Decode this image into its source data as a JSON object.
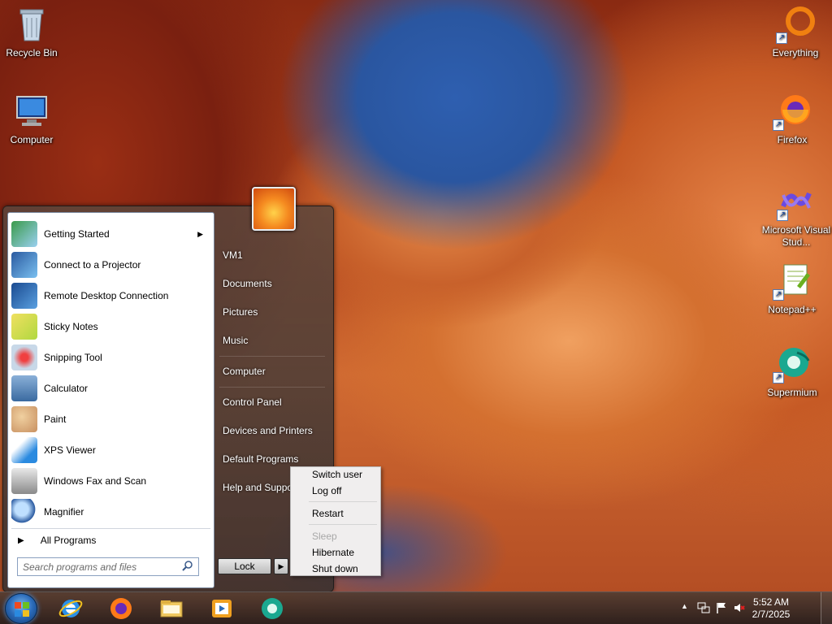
{
  "desktop": {
    "icons": [
      {
        "label": "Recycle Bin",
        "icon": "recycle-bin-icon"
      },
      {
        "label": "Computer",
        "icon": "computer-icon"
      },
      {
        "label": "Everything",
        "icon": "everything-icon"
      },
      {
        "label": "Firefox",
        "icon": "firefox-icon"
      },
      {
        "label": "Microsoft Visual Stud...",
        "icon": "visual-studio-icon"
      },
      {
        "label": "Notepad++",
        "icon": "notepad-plus-plus-icon"
      },
      {
        "label": "Supermium",
        "icon": "supermium-icon"
      }
    ]
  },
  "start_menu": {
    "programs": [
      {
        "label": "Getting Started",
        "icon": "getting-started-icon",
        "has_submenu": true
      },
      {
        "label": "Connect to a Projector",
        "icon": "projector-icon"
      },
      {
        "label": "Remote Desktop Connection",
        "icon": "remote-desktop-icon"
      },
      {
        "label": "Sticky Notes",
        "icon": "sticky-notes-icon"
      },
      {
        "label": "Snipping Tool",
        "icon": "snipping-tool-icon"
      },
      {
        "label": "Calculator",
        "icon": "calculator-icon"
      },
      {
        "label": "Paint",
        "icon": "paint-icon"
      },
      {
        "label": "XPS Viewer",
        "icon": "xps-viewer-icon"
      },
      {
        "label": "Windows Fax and Scan",
        "icon": "fax-scan-icon"
      },
      {
        "label": "Magnifier",
        "icon": "magnifier-icon"
      }
    ],
    "all_programs": "All Programs",
    "search_placeholder": "Search programs and files",
    "right_items": {
      "user": "VM1",
      "documents": "Documents",
      "pictures": "Pictures",
      "music": "Music",
      "computer": "Computer",
      "control_panel": "Control Panel",
      "devices_printers": "Devices and Printers",
      "default_programs": "Default Programs",
      "help_support": "Help and Support"
    },
    "lock_label": "Lock",
    "power_menu": {
      "switch_user": "Switch user",
      "log_off": "Log off",
      "restart": "Restart",
      "sleep": "Sleep",
      "hibernate": "Hibernate",
      "shut_down": "Shut down"
    }
  },
  "taskbar": {
    "apps": [
      "internet-explorer-icon",
      "firefox-icon",
      "file-explorer-icon",
      "media-player-icon",
      "supermium-icon"
    ],
    "clock": {
      "time": "5:52 AM",
      "date": "2/7/2025"
    }
  },
  "colors": {
    "taskbar_bg": "#3a2c28",
    "accent_blue": "#2a6ab8"
  }
}
